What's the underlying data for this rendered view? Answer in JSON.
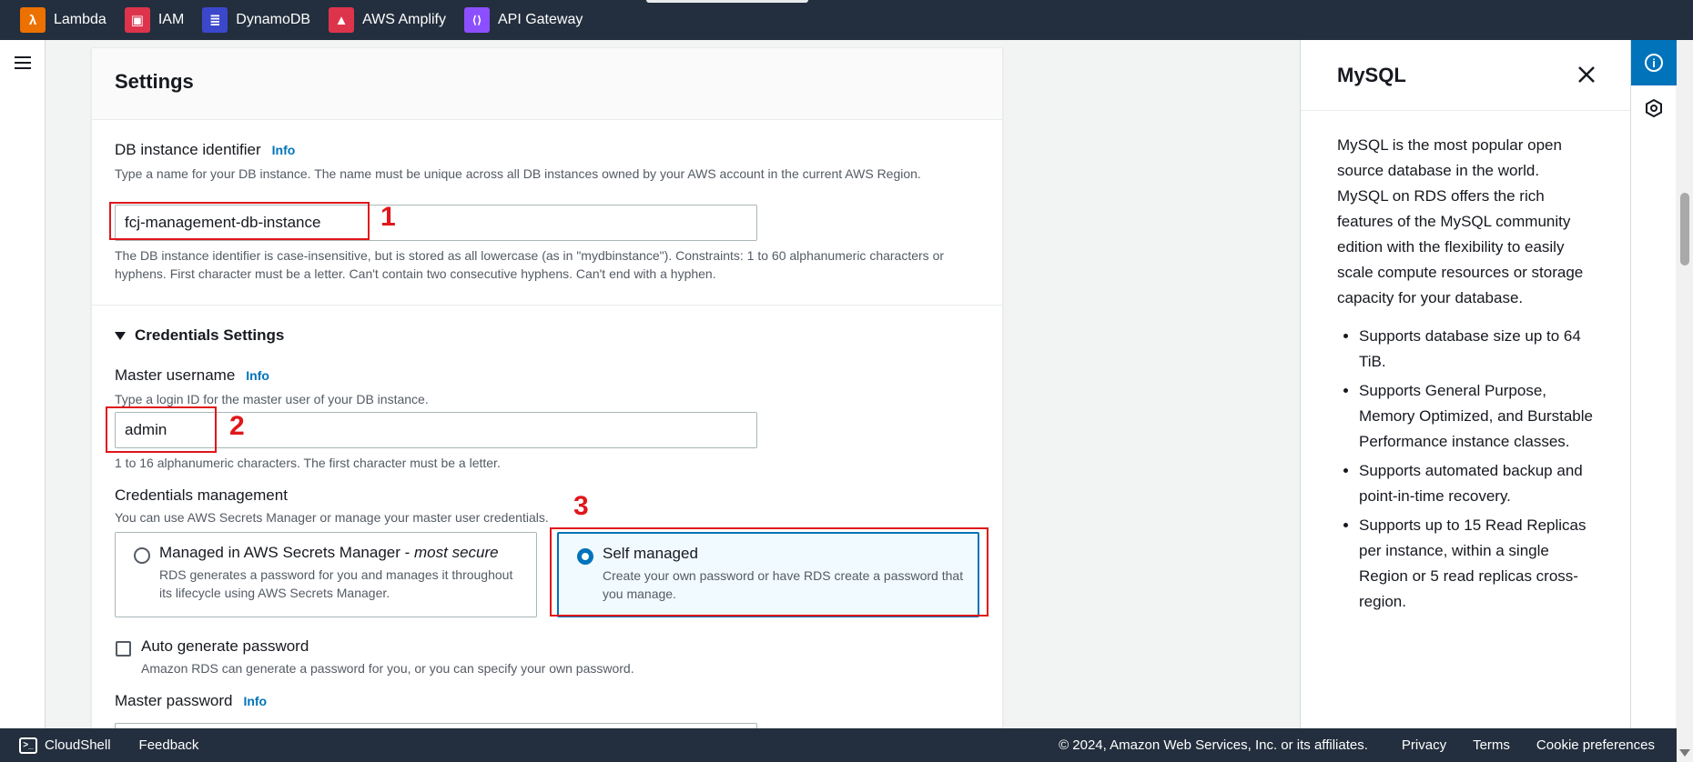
{
  "topnav": {
    "services": [
      {
        "label": "Lambda",
        "icon": "lambda-icon",
        "color": "#ed7100",
        "glyph": "λ"
      },
      {
        "label": "IAM",
        "icon": "iam-icon",
        "color": "#dd344c",
        "glyph": "▣"
      },
      {
        "label": "DynamoDB",
        "icon": "dynamodb-icon",
        "color": "#3b48cc",
        "glyph": "≣"
      },
      {
        "label": "AWS Amplify",
        "icon": "amplify-icon",
        "color": "#dd344c",
        "glyph": "▲"
      },
      {
        "label": "API Gateway",
        "icon": "api-gateway-icon",
        "color": "#8c4fff",
        "glyph": "⟨⟩"
      }
    ]
  },
  "settings": {
    "title": "Settings",
    "db_identifier": {
      "label": "DB instance identifier",
      "info": "Info",
      "description": "Type a name for your DB instance. The name must be unique across all DB instances owned by your AWS account in the current AWS Region.",
      "value": "fcj-management-db-instance",
      "constraint": "The DB instance identifier is case-insensitive, but is stored as all lowercase (as in \"mydbinstance\"). Constraints: 1 to 60 alphanumeric characters or hyphens. First character must be a letter. Can't contain two consecutive hyphens. Can't end with a hyphen."
    },
    "credentials": {
      "section_title": "Credentials Settings",
      "master_username": {
        "label": "Master username",
        "info": "Info",
        "description": "Type a login ID for the master user of your DB instance.",
        "value": "admin",
        "constraint": "1 to 16 alphanumeric characters. The first character must be a letter."
      },
      "management": {
        "label": "Credentials management",
        "description": "You can use AWS Secrets Manager or manage your master user credentials.",
        "options": [
          {
            "title": "Managed in AWS Secrets Manager - ",
            "title_em": "most secure",
            "desc": "RDS generates a password for you and manages it throughout its lifecycle using AWS Secrets Manager.",
            "selected": false
          },
          {
            "title": "Self managed",
            "title_em": "",
            "desc": "Create your own password or have RDS create a password that you manage.",
            "selected": true
          }
        ]
      },
      "auto_generate": {
        "label": "Auto generate password",
        "description": "Amazon RDS can generate a password for you, or you can specify your own password.",
        "checked": false
      },
      "master_password": {
        "label": "Master password",
        "info": "Info"
      }
    }
  },
  "annotations": [
    "1",
    "2",
    "3"
  ],
  "help_panel": {
    "title": "MySQL",
    "intro": "MySQL is the most popular open source database in the world. MySQL on RDS offers the rich features of the MySQL community edition with the flexibility to easily scale compute resources or storage capacity for your database.",
    "bullets": [
      "Supports database size up to 64 TiB.",
      "Supports General Purpose, Memory Optimized, and Burstable Performance instance classes.",
      "Supports automated backup and point-in-time recovery.",
      "Supports up to 15 Read Replicas per instance, within a single Region or 5 read replicas cross-region."
    ]
  },
  "footer": {
    "cloudshell": "CloudShell",
    "feedback": "Feedback",
    "copyright": "© 2024, Amazon Web Services, Inc. or its affiliates.",
    "links": [
      "Privacy",
      "Terms",
      "Cookie preferences"
    ]
  },
  "colors": {
    "annotation": "#e0171b",
    "link": "#0073bb",
    "nav_bg": "#232f3e"
  }
}
